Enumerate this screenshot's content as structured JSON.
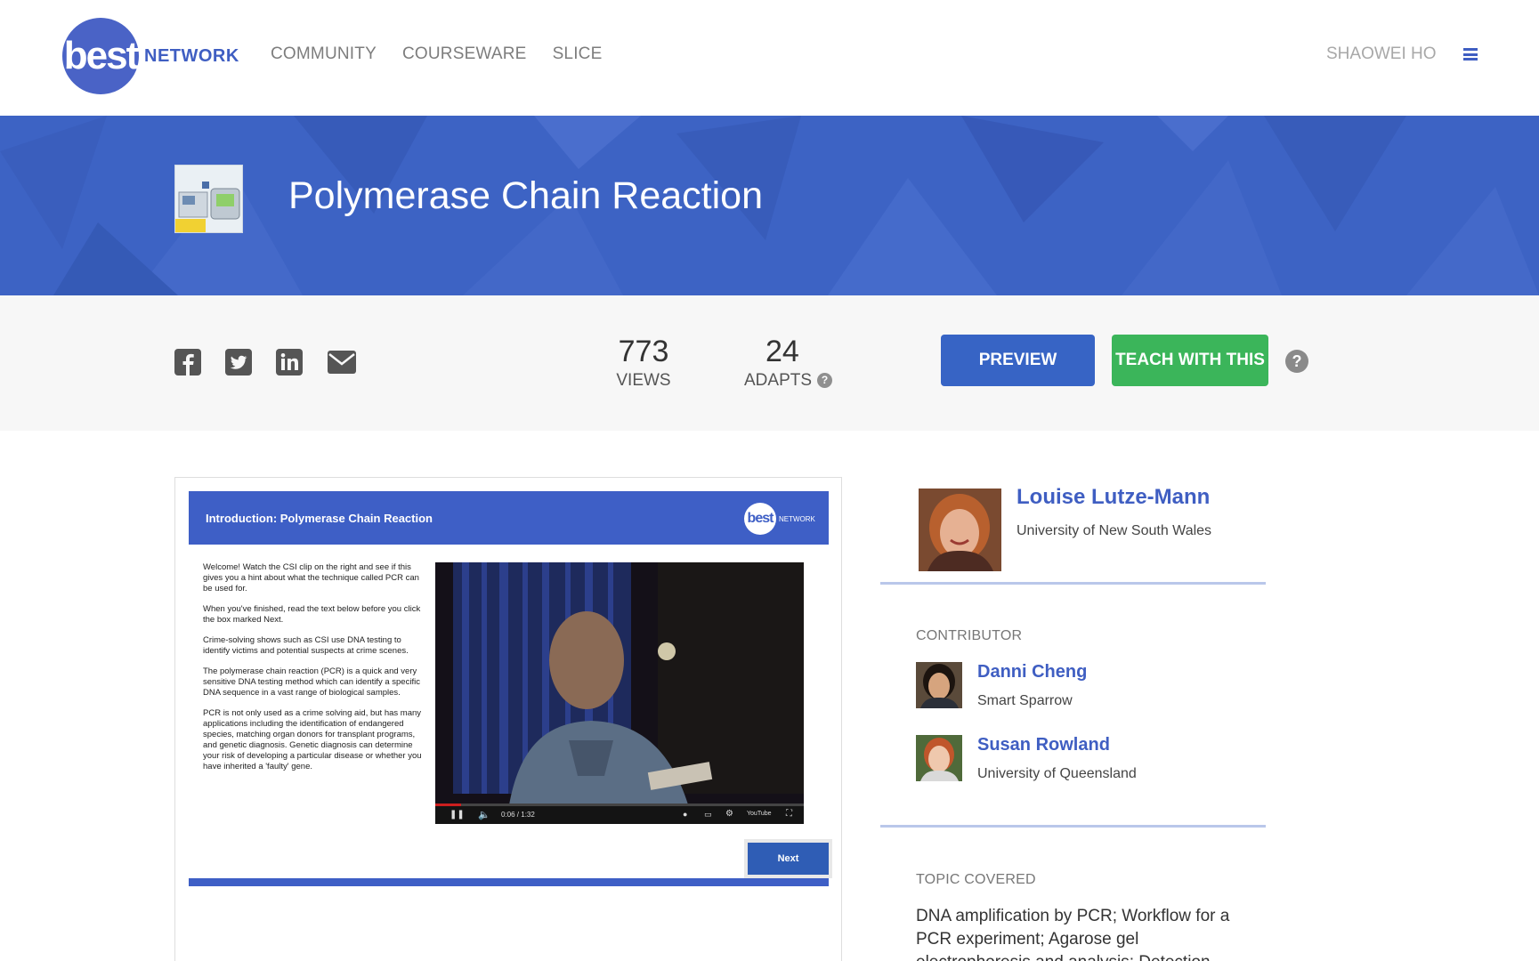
{
  "nav": {
    "logo_main": "best",
    "logo_sub": "NETWORK",
    "links": [
      "COMMUNITY",
      "COURSEWARE",
      "SLICE"
    ],
    "user": "SHAOWEI HO"
  },
  "banner": {
    "title": "Polymerase Chain Reaction"
  },
  "actions": {
    "views_count": "773",
    "views_label": "VIEWS",
    "adapts_count": "24",
    "adapts_label": "ADAPTS",
    "preview_label": "PREVIEW",
    "teach_label": "TEACH WITH THIS",
    "help_glyph": "?"
  },
  "slide": {
    "title": "Introduction: Polymerase Chain Reaction",
    "logo_main": "best",
    "logo_sub": "NETWORK",
    "paragraphs": [
      "Welcome! Watch the CSI clip on the right and see if this gives you a hint about what the technique called PCR can be used for.",
      "When you've finished, read the text below before you click the box marked Next.",
      "Crime-solving shows such as CSI use DNA testing to identify victims and potential suspects at crime scenes.",
      "The polymerase chain reaction (PCR) is a quick and very sensitive DNA testing method which can identify a specific DNA sequence in a vast range of biological samples.",
      "PCR is not only used as a crime solving aid, but has many applications including the identification of endangered species, matching organ donors for transplant programs, and genetic diagnosis. Genetic diagnosis can determine your risk of developing a particular disease or whether you have inherited a 'faulty' gene."
    ],
    "video_time": "0:06 / 1:32",
    "video_progress": 0.07,
    "next_label": "Next"
  },
  "author": {
    "name": "Louise Lutze-Mann",
    "org": "University of New South Wales"
  },
  "contributors": {
    "label": "CONTRIBUTOR",
    "people": [
      {
        "name": "Danni Cheng",
        "org": "Smart Sparrow"
      },
      {
        "name": "Susan Rowland",
        "org": "University of Queensland"
      }
    ]
  },
  "topic": {
    "label": "TOPIC COVERED",
    "text": "DNA amplification by PCR; Workflow for a PCR experiment; Agarose gel electrophoresis and analysis; Detection"
  },
  "colors": {
    "brand_blue": "#3f5ec2",
    "banner_blue": "#3d63c4",
    "teach_green": "#3bb55a"
  }
}
